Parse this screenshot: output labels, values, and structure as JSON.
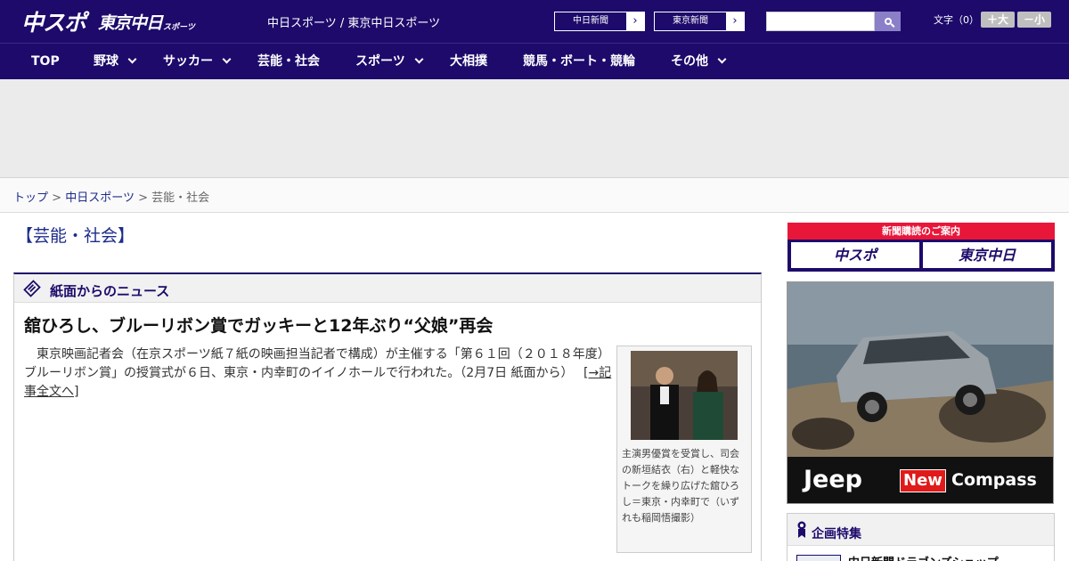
{
  "header": {
    "logo_main": "中スポ",
    "logo_second": "東京中日",
    "logo_small": "スポーツ",
    "site_subtitle": "中日スポーツ / 東京中日スポーツ",
    "ext_links": [
      "中日新聞",
      "東京新聞"
    ],
    "font_label": "文字（0）",
    "font_larger": "＋大",
    "font_smaller": "－小"
  },
  "nav": {
    "items": [
      {
        "label": "TOP",
        "dropdown": false
      },
      {
        "label": "野球",
        "dropdown": true
      },
      {
        "label": "サッカー",
        "dropdown": true
      },
      {
        "label": "芸能・社会",
        "dropdown": false
      },
      {
        "label": "スポーツ",
        "dropdown": true
      },
      {
        "label": "大相撲",
        "dropdown": false
      },
      {
        "label": "競馬・ボート・競輪",
        "dropdown": false
      },
      {
        "label": "その他",
        "dropdown": true
      }
    ]
  },
  "breadcrumb": {
    "home": "トップ",
    "section": "中日スポーツ",
    "current": "芸能・社会",
    "separator": ">"
  },
  "section_title": "【芸能・社会】",
  "news": {
    "heading": "紙面からのニュース",
    "headline": "舘ひろし、ブルーリボン賞でガッキーと12年ぶり“父娘”再会",
    "body": "東京映画記者会（在京スポーツ紙７紙の映画担当記者で構成）が主催する「第６１回（２０１８年度）ブルーリボン賞」の授賞式が６日、東京・内幸町のイイノホールで行われた。（2月7日 紙面から）",
    "more_link": "[→記事全文へ]",
    "caption": "主演男優賞を受賞し、司会の新垣結衣（右）と軽快なトークを繰り広げた舘ひろし＝東京・内幸町で（いずれも稲岡悟撮影）"
  },
  "sidebar": {
    "subscribe_title": "新聞購読のご案内",
    "subscribe_buttons": [
      "中スポ",
      "東京中日"
    ],
    "ad": {
      "brand": "Jeep",
      "badge": "New",
      "model": "Compass"
    },
    "feature_title": "企画特集",
    "feature_item": "中日新聞ドラゴンズショップ"
  },
  "colors": {
    "brand_navy": "#1d0a6b",
    "link_blue": "#1d2b8a",
    "subscribe_red": "#e8173a"
  }
}
